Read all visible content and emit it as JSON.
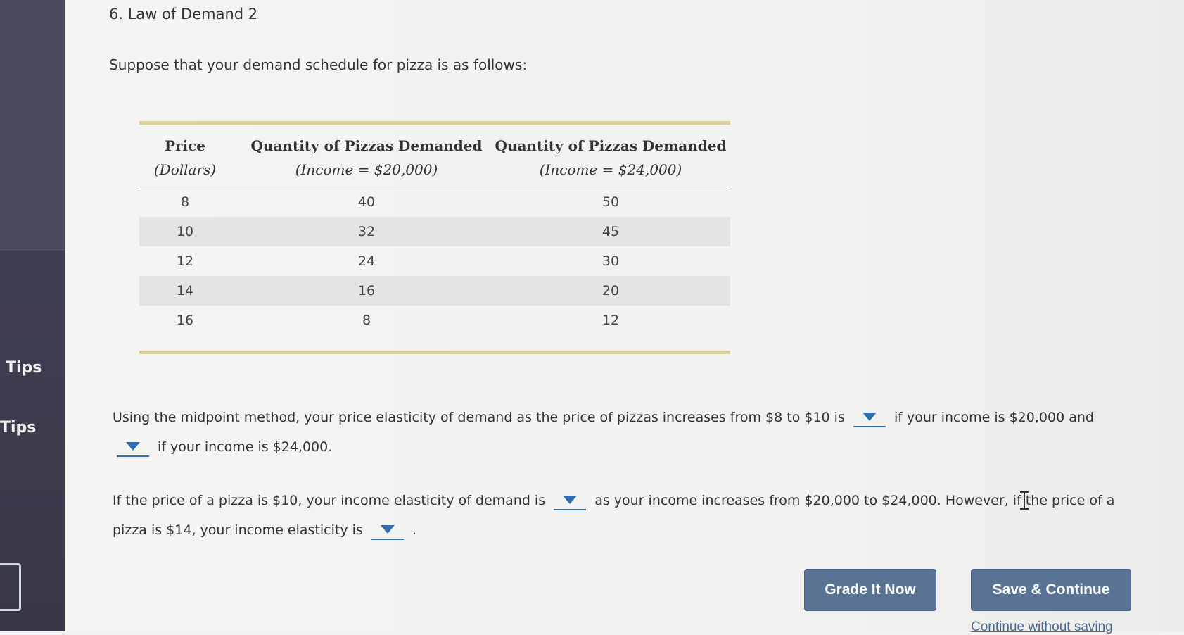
{
  "sidebar": {
    "tips_1": "Tips",
    "tips_2": "Tips"
  },
  "question": {
    "title": "6. Law of Demand 2",
    "intro": "Suppose that your demand schedule for pizza is as follows:"
  },
  "table": {
    "headers": [
      {
        "line1": "Price",
        "line2": "(Dollars)"
      },
      {
        "line1": "Quantity of Pizzas Demanded",
        "line2": "(Income = $20,000)"
      },
      {
        "line1": "Quantity of Pizzas Demanded",
        "line2": "(Income = $24,000)"
      }
    ],
    "rows": [
      [
        "8",
        "40",
        "50"
      ],
      [
        "10",
        "32",
        "45"
      ],
      [
        "12",
        "24",
        "30"
      ],
      [
        "14",
        "16",
        "20"
      ],
      [
        "16",
        "8",
        "12"
      ]
    ]
  },
  "paragraph1": {
    "part_a": "Using the midpoint method, your price elasticity of demand as the price of pizzas increases from $8 to $10 is",
    "part_b": "if your income is $20,000 and",
    "part_c": "if your income is $24,000."
  },
  "paragraph2": {
    "part_a": "If the price of a pizza is $10, your income elasticity of demand is",
    "part_b": "as your income increases from $20,000 to $24,000. However, if the price of a pizza is $14, your income elasticity is",
    "part_c": "."
  },
  "buttons": {
    "grade": "Grade It Now",
    "save": "Save & Continue",
    "continue_without": "Continue without saving"
  },
  "colors": {
    "accent": "#2f6fb0",
    "button": "#5a7395",
    "table_rule": "#d9cf9e",
    "sidebar": "#414155"
  }
}
